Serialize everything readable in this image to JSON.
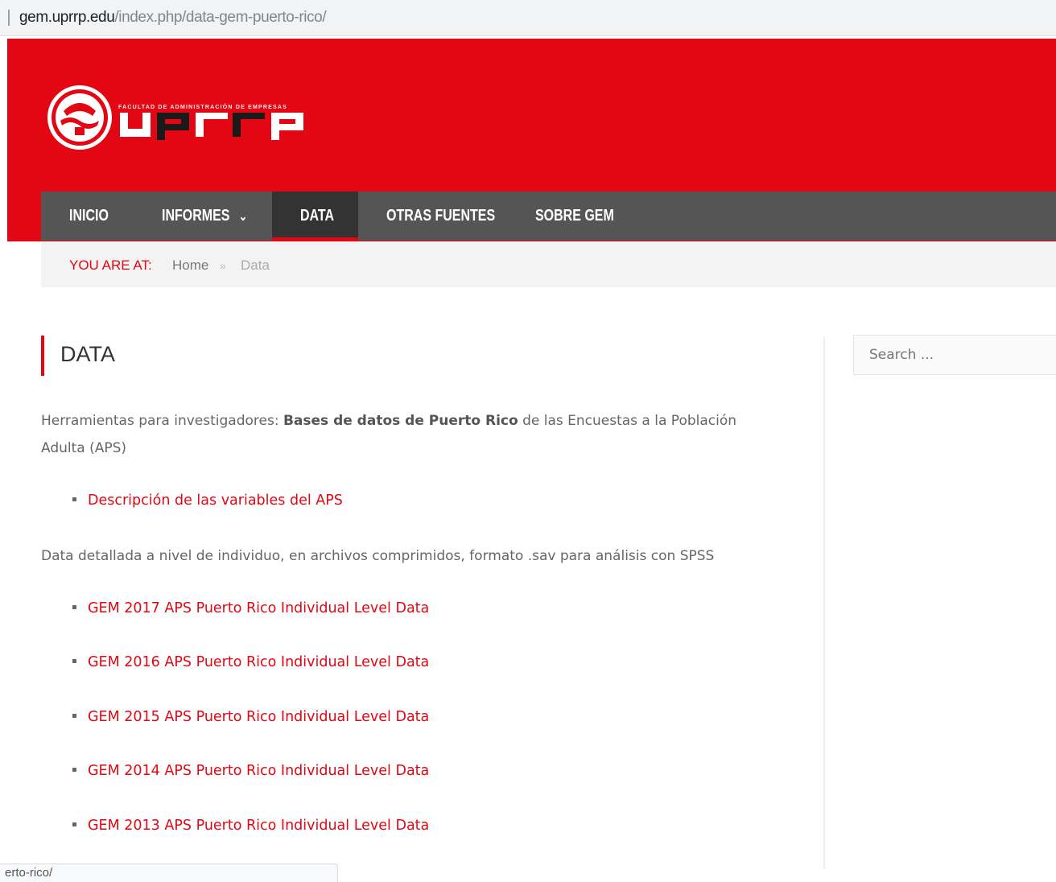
{
  "browser": {
    "url_host": "gem.uprrp.edu",
    "url_path": "/index.php/data-gem-puerto-rico/",
    "status_url": "erto-rico/"
  },
  "header": {
    "logo_text": "uprrp",
    "logo_subtitle": "FACULTAD DE ADMINISTRACIÓN DE EMPRESAS",
    "brand_color": "#e30613"
  },
  "nav": {
    "items": [
      {
        "label": "INICIO"
      },
      {
        "label": "INFORMES"
      },
      {
        "label": "DATA"
      },
      {
        "label": "OTRAS FUENTES"
      },
      {
        "label": "SOBRE GEM"
      }
    ],
    "active": "DATA"
  },
  "breadcrumb": {
    "label": "YOU ARE AT:",
    "home": "Home",
    "separator": "»",
    "current": "Data"
  },
  "main": {
    "title": "DATA",
    "intro_prefix": "Herramientas para investigadores: ",
    "intro_bold": "Bases de datos de Puerto Rico",
    "intro_suffix": " de las Encuestas a la Población Adulta (APS)",
    "variables_link": "Descripción de las variables del APS",
    "detail_text": "Data detallada a nivel de individuo, en archivos comprimidos, formato .sav para análisis con SPSS",
    "data_links": [
      "GEM 2017 APS Puerto Rico Individual Level Data",
      "GEM 2016 APS Puerto Rico Individual Level Data",
      "GEM 2015 APS Puerto Rico Individual Level Data",
      "GEM 2014 APS Puerto Rico Individual Level Data",
      "GEM 2013 APS Puerto Rico Individual Level Data"
    ]
  },
  "sidebar": {
    "search_placeholder": "Search ..."
  }
}
